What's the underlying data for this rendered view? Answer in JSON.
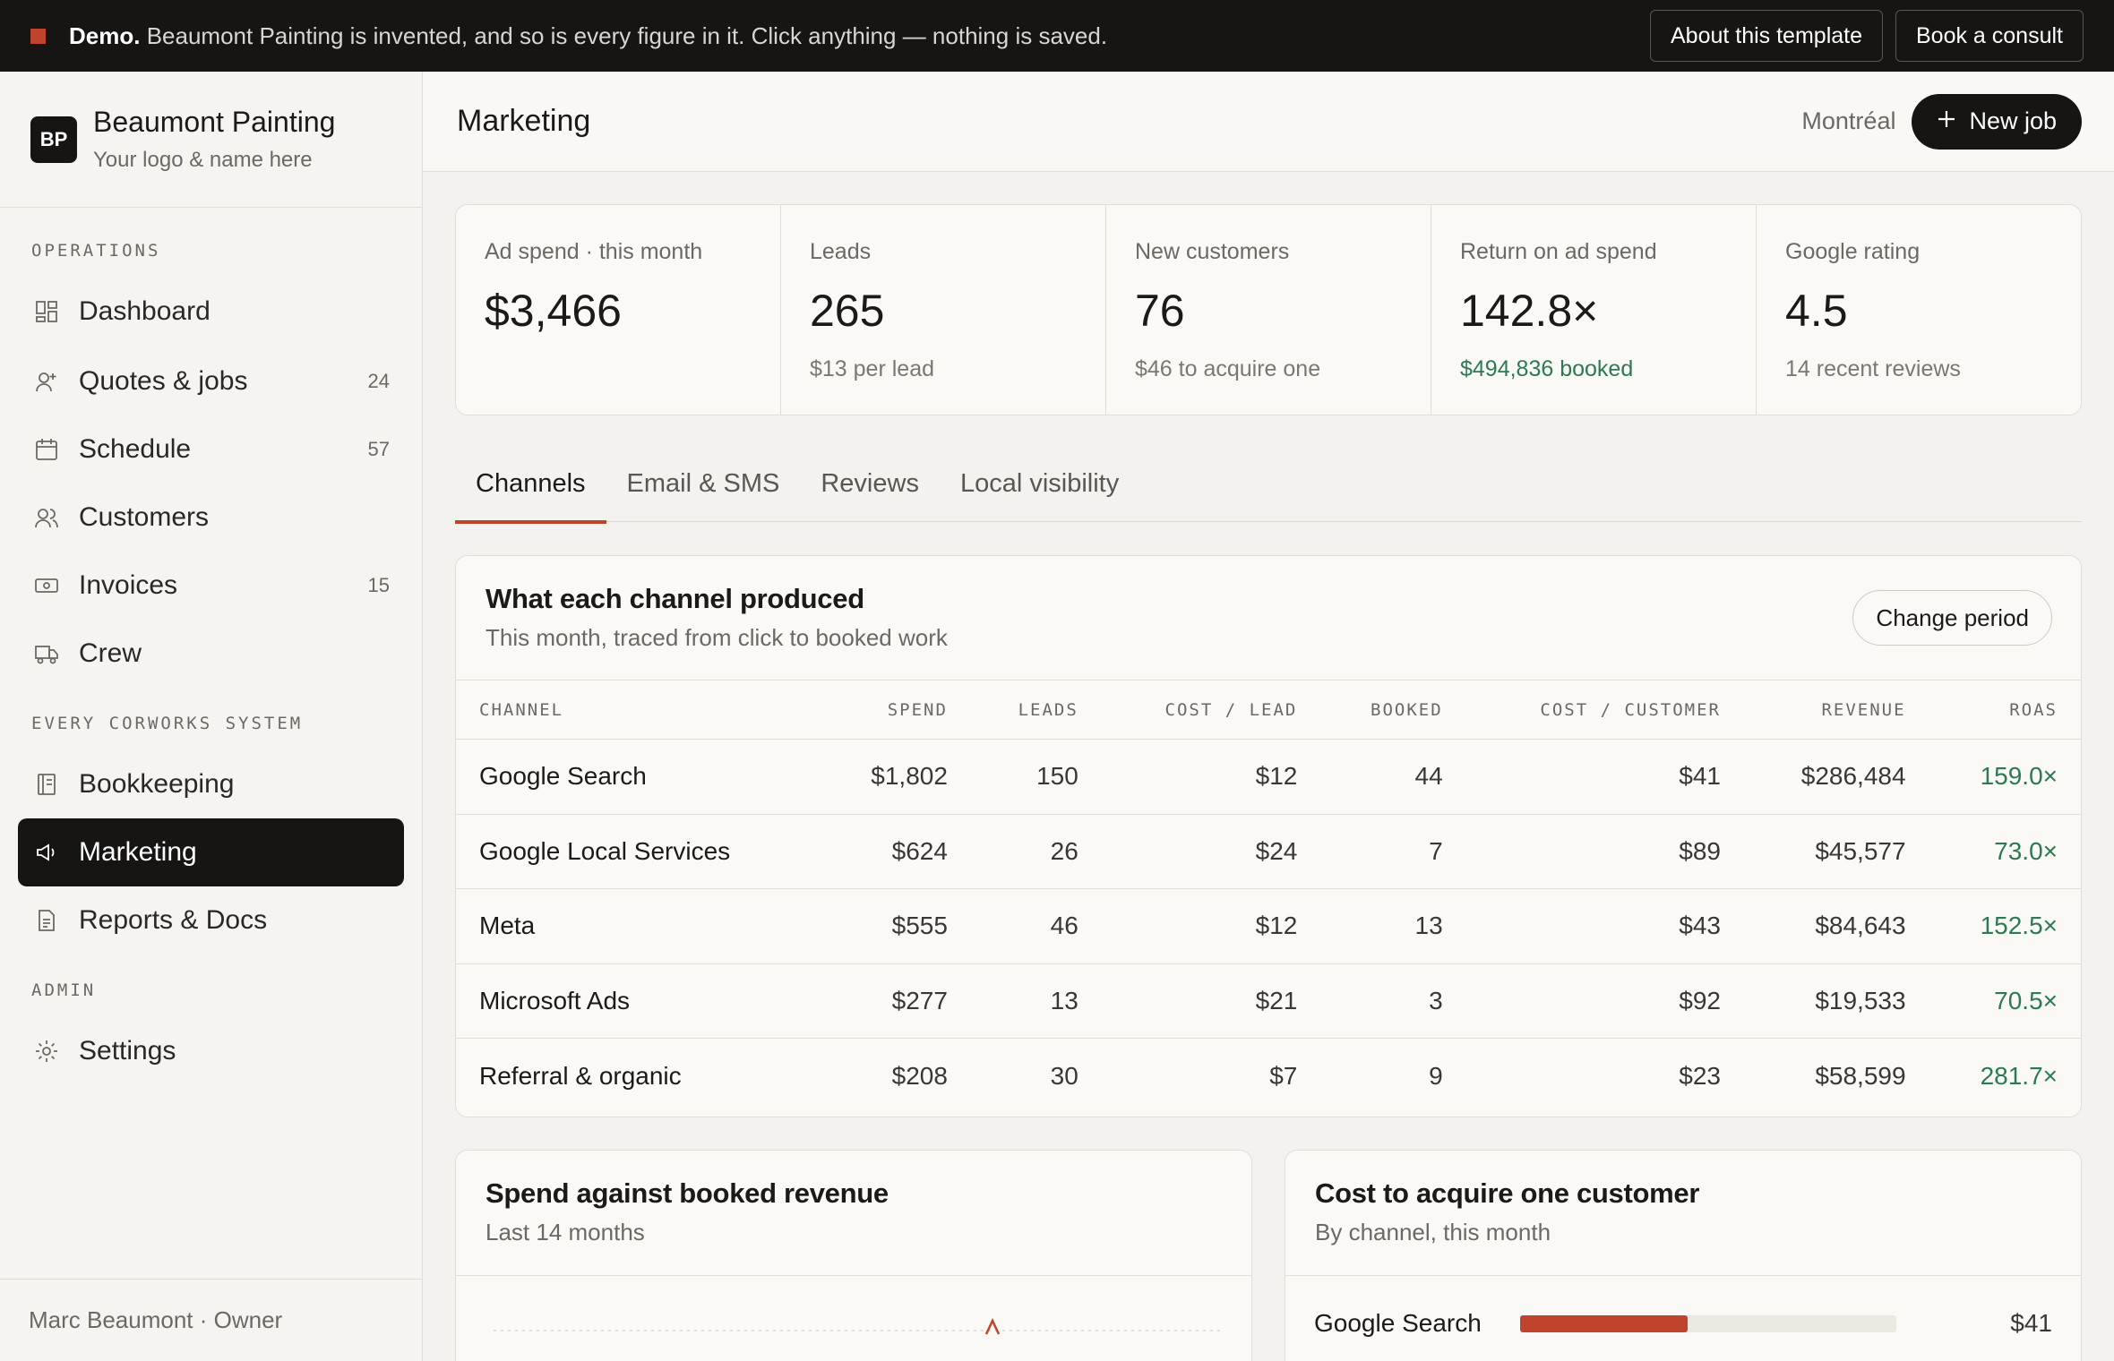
{
  "banner": {
    "lead": "Demo.",
    "text": " Beaumont Painting is invented, and so is every figure in it. Click anything — nothing is saved.",
    "about_btn": "About this template",
    "consult_btn": "Book a consult"
  },
  "brand": {
    "logo": "BP",
    "name": "Beaumont Painting",
    "sub": "Your logo & name here"
  },
  "sidebar": {
    "section_ops": "OPERATIONS",
    "section_sys": "EVERY CORWORKS SYSTEM",
    "section_admin": "ADMIN",
    "items": [
      {
        "label": "Dashboard",
        "count": "",
        "icon": "dashboard-icon"
      },
      {
        "label": "Quotes & jobs",
        "count": "24",
        "icon": "user-plus-icon"
      },
      {
        "label": "Schedule",
        "count": "57",
        "icon": "calendar-icon"
      },
      {
        "label": "Customers",
        "count": "",
        "icon": "users-icon"
      },
      {
        "label": "Invoices",
        "count": "15",
        "icon": "cash-icon"
      },
      {
        "label": "Crew",
        "count": "",
        "icon": "truck-icon"
      },
      {
        "label": "Bookkeeping",
        "count": "",
        "icon": "ledger-icon"
      },
      {
        "label": "Marketing",
        "count": "",
        "icon": "megaphone-icon"
      },
      {
        "label": "Reports & Docs",
        "count": "",
        "icon": "document-icon"
      },
      {
        "label": "Settings",
        "count": "",
        "icon": "gear-icon"
      }
    ],
    "footer": "Marc Beaumont · Owner"
  },
  "topbar": {
    "title": "Marketing",
    "city": "Montréal",
    "new_job": "New job"
  },
  "kpis": [
    {
      "label": "Ad spend · this month",
      "value": "$3,466",
      "sub": ""
    },
    {
      "label": "Leads",
      "value": "265",
      "sub": "$13 per lead"
    },
    {
      "label": "New customers",
      "value": "76",
      "sub": "$46 to acquire one"
    },
    {
      "label": "Return on ad spend",
      "value": "142.8×",
      "sub": "$494,836 booked"
    },
    {
      "label": "Google rating",
      "value": "4.5",
      "sub": "14 recent reviews"
    }
  ],
  "tabs": [
    "Channels",
    "Email & SMS",
    "Reviews",
    "Local visibility"
  ],
  "channels_card": {
    "title": "What each channel produced",
    "sub": "This month, traced from click to booked work",
    "period_btn": "Change period",
    "headers": [
      "CHANNEL",
      "SPEND",
      "LEADS",
      "COST / LEAD",
      "BOOKED",
      "COST / CUSTOMER",
      "REVENUE",
      "ROAS"
    ],
    "rows": [
      [
        "Google Search",
        "$1,802",
        "150",
        "$12",
        "44",
        "$41",
        "$286,484",
        "159.0×"
      ],
      [
        "Google Local Services",
        "$624",
        "26",
        "$24",
        "7",
        "$89",
        "$45,577",
        "73.0×"
      ],
      [
        "Meta",
        "$555",
        "46",
        "$12",
        "13",
        "$43",
        "$84,643",
        "152.5×"
      ],
      [
        "Microsoft Ads",
        "$277",
        "13",
        "$21",
        "3",
        "$92",
        "$19,533",
        "70.5×"
      ],
      [
        "Referral & organic",
        "$208",
        "30",
        "$7",
        "9",
        "$23",
        "$58,599",
        "281.7×"
      ]
    ]
  },
  "spend_card": {
    "title": "Spend against booked revenue",
    "sub": "Last 14 months"
  },
  "cac_card": {
    "title": "Cost to acquire one customer",
    "sub": "By channel, this month",
    "bars": [
      {
        "label": "Google Search",
        "value": "$41",
        "fraction": 0.445
      }
    ]
  },
  "colors": {
    "accent": "#c0442b",
    "positive": "#2c7a52",
    "ink": "#161514"
  }
}
